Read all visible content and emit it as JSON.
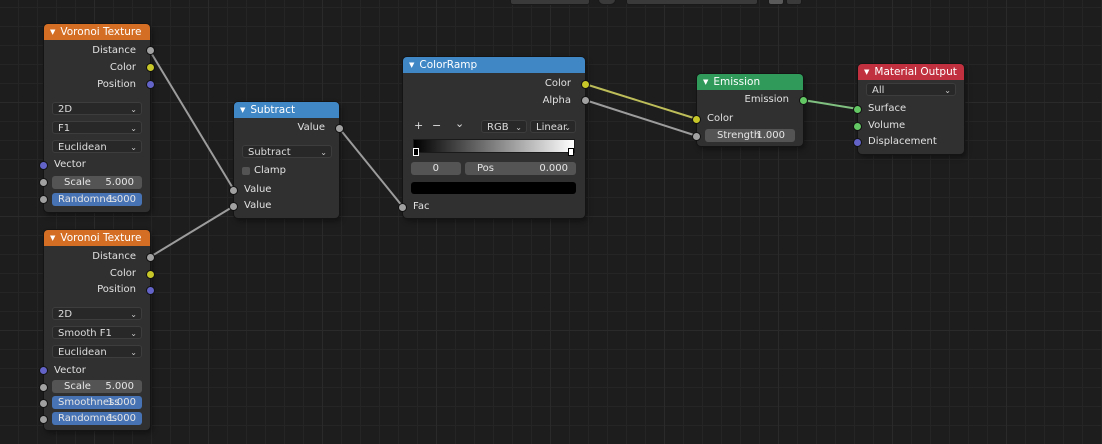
{
  "colors": {
    "voronoi_header": "#d36e24",
    "converter_header": "#3f87c5",
    "shader_header": "#2f9a5a",
    "output_header": "#c0303e",
    "socket_float": "#a1a1a1",
    "socket_color": "#c7c729",
    "socket_vector": "#6363c7",
    "socket_shader": "#63c763",
    "field_highlight": "#4772b3"
  },
  "voronoi1": {
    "title": "Voronoi Texture",
    "outputs": [
      "Distance",
      "Color",
      "Position"
    ],
    "dims": "2D",
    "feature": "F1",
    "metric": "Euclidean",
    "vector_label": "Vector",
    "scale_label": "Scale",
    "scale_value": "5.000",
    "random_label": "Randomnes",
    "random_value": "1.000"
  },
  "voronoi2": {
    "title": "Voronoi Texture",
    "outputs": [
      "Distance",
      "Color",
      "Position"
    ],
    "dims": "2D",
    "feature": "Smooth F1",
    "metric": "Euclidean",
    "vector_label": "Vector",
    "scale_label": "Scale",
    "scale_value": "5.000",
    "smooth_label": "Smoothness",
    "smooth_value": "1.000",
    "random_label": "Randomnes",
    "random_value": "1.000"
  },
  "math": {
    "title": "Subtract",
    "output": "Value",
    "operation": "Subtract",
    "clamp_label": "Clamp",
    "input1": "Value",
    "input2": "Value"
  },
  "ramp": {
    "title": "ColorRamp",
    "out_color": "Color",
    "out_alpha": "Alpha",
    "add": "+",
    "remove": "−",
    "menu": "⌄",
    "mode": "RGB",
    "interp": "Linear",
    "index": "0",
    "pos_label": "Pos",
    "pos_value": "0.000",
    "input": "Fac"
  },
  "emission": {
    "title": "Emission",
    "output": "Emission",
    "color_label": "Color",
    "strength_label": "Strength",
    "strength_value": "1.000"
  },
  "output": {
    "title": "Material Output",
    "target": "All",
    "surface": "Surface",
    "volume": "Volume",
    "displacement": "Displacement"
  }
}
